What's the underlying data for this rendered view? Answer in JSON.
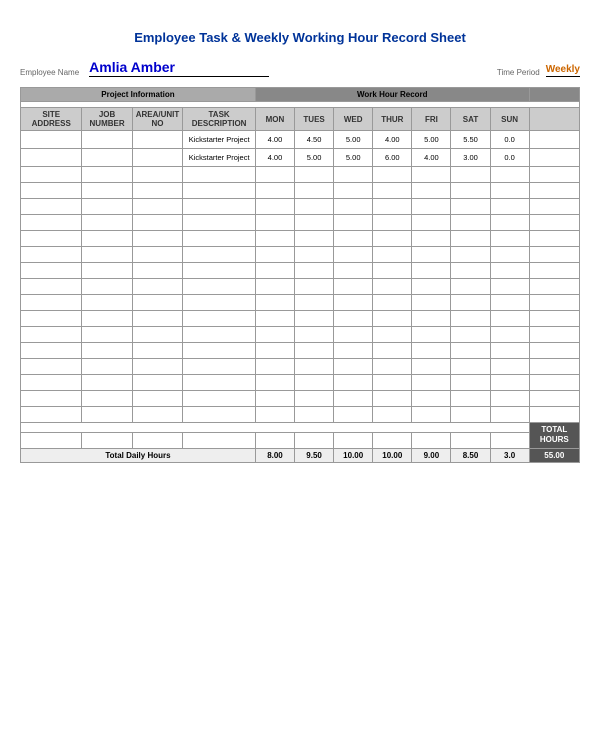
{
  "page": {
    "title": "Employee Task & Weekly Working Hour Record Sheet"
  },
  "header": {
    "employee_name_label": "Employee Name",
    "employee_name": "Amlia Amber",
    "time_period_label": "Time Period",
    "time_period_value": "Weekly"
  },
  "table": {
    "project_info_label": "Project Information",
    "work_hour_record_label": "Work Hour Record",
    "columns": {
      "site_address": "SITE ADDRESS",
      "job_number": "JOB NUMBER",
      "area_unit_no": "AREA/UNIT NO",
      "task_description": "TASK DESCRIPTION",
      "mon": "MON",
      "tue": "TUES",
      "wed": "WED",
      "thu": "THUR",
      "fri": "FRI",
      "sat": "SAT",
      "sun": "SUN"
    },
    "data_rows": [
      {
        "site": "",
        "job": "",
        "area": "",
        "task": "Kickstarter Project",
        "mon": "4.00",
        "tue": "4.50",
        "wed": "5.00",
        "thu": "4.00",
        "fri": "5.00",
        "sat": "5.50",
        "sun": "0.0"
      },
      {
        "site": "",
        "job": "",
        "area": "",
        "task": "Kickstarter Project",
        "mon": "4.00",
        "tue": "5.00",
        "wed": "5.00",
        "thu": "6.00",
        "fri": "4.00",
        "sat": "3.00",
        "sun": "0.0"
      }
    ],
    "empty_rows": 16,
    "total_label": "Total Daily Hours",
    "totals": {
      "mon": "8.00",
      "tue": "9.50",
      "wed": "10.00",
      "thu": "10.00",
      "fri": "9.00",
      "sat": "8.50",
      "sun": "3.0",
      "total": "55.00"
    },
    "total_hours_header": "TOTAL HOURS"
  }
}
